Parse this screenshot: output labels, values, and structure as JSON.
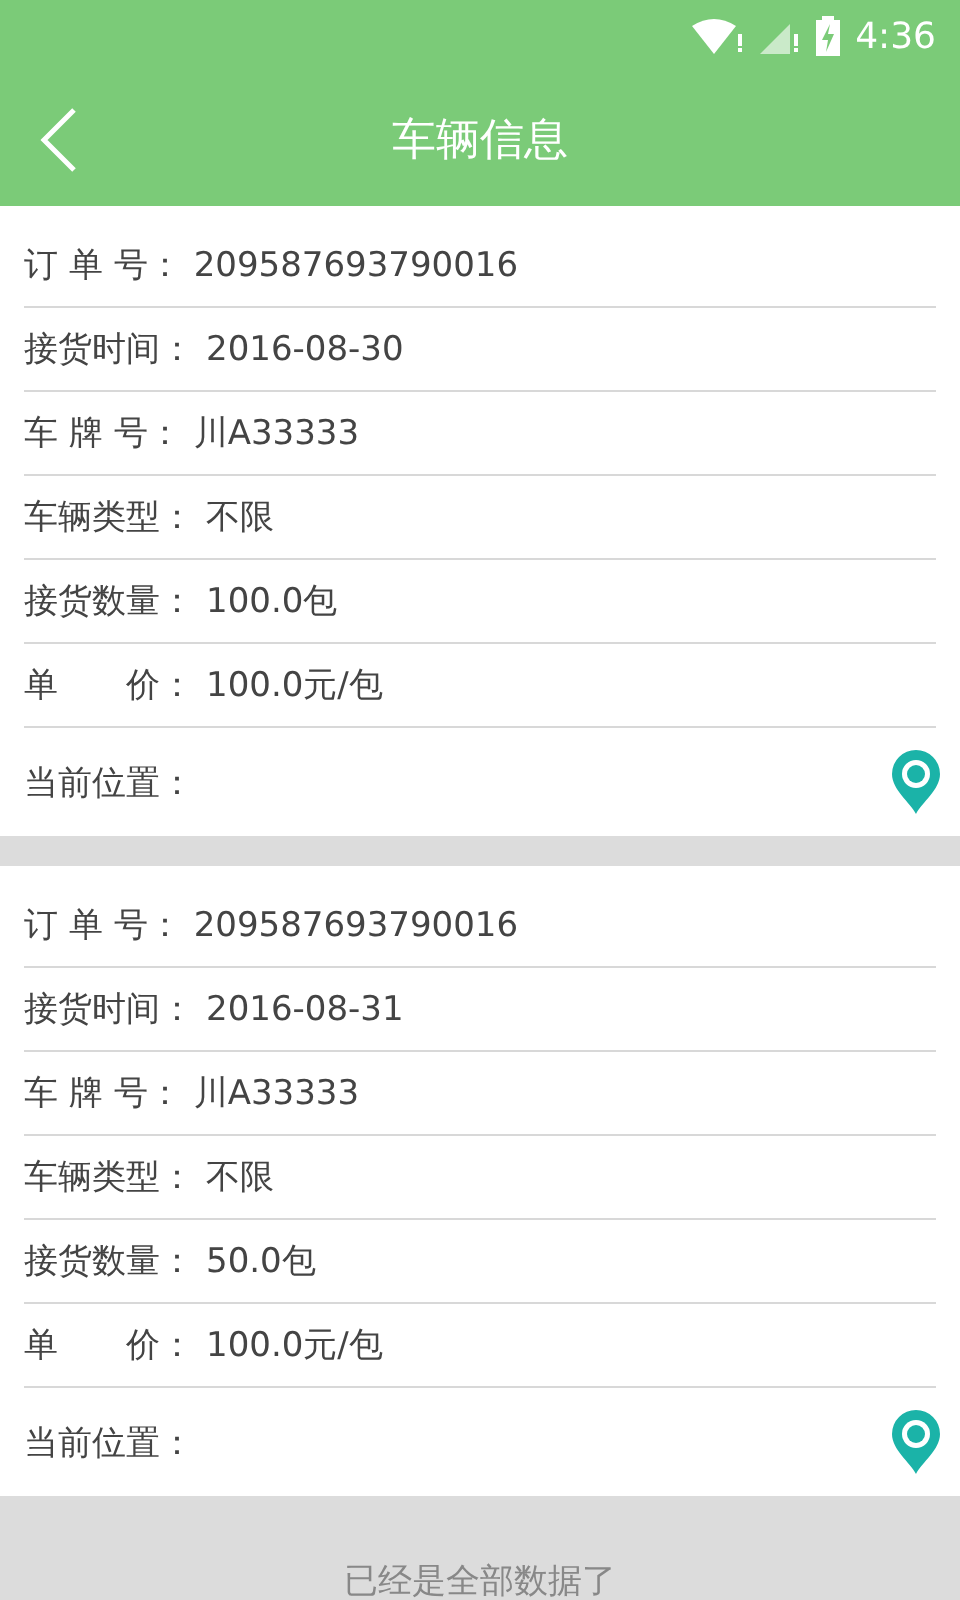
{
  "status_bar": {
    "time": "4:36"
  },
  "header": {
    "title": "车辆信息"
  },
  "orders": [
    {
      "fields": [
        {
          "label": "订 单 号：",
          "value": "209587693790016"
        },
        {
          "label": "接货时间：",
          "value": "2016-08-30"
        },
        {
          "label": "车 牌 号：",
          "value": "川A33333"
        },
        {
          "label": "车辆类型：",
          "value": "不限"
        },
        {
          "label": "接货数量：",
          "value": "100.0包"
        },
        {
          "label": "单　　价：",
          "value": "100.0元/包"
        }
      ],
      "location_label": "当前位置："
    },
    {
      "fields": [
        {
          "label": "订 单 号：",
          "value": "209587693790016"
        },
        {
          "label": "接货时间：",
          "value": "2016-08-31"
        },
        {
          "label": "车 牌 号：",
          "value": "川A33333"
        },
        {
          "label": "车辆类型：",
          "value": "不限"
        },
        {
          "label": "接货数量：",
          "value": "50.0包"
        },
        {
          "label": "单　　价：",
          "value": "100.0元/包"
        }
      ],
      "location_label": "当前位置："
    }
  ],
  "footer": {
    "text": "已经是全部数据了"
  }
}
